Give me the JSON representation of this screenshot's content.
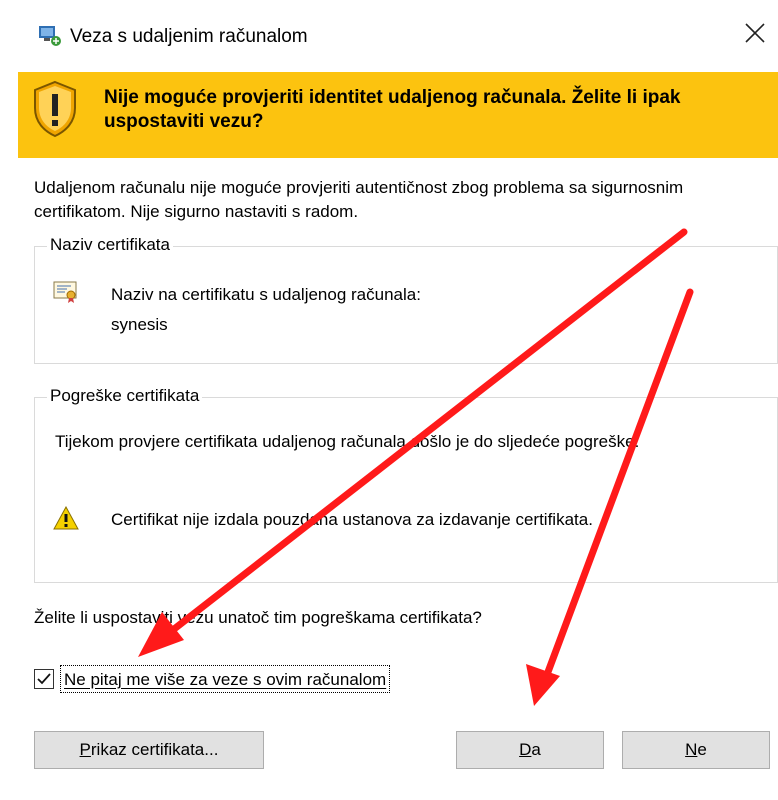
{
  "window": {
    "title": "Veza s udaljenim računalom",
    "app_icon": "remote-desktop-icon",
    "close_icon": "close-icon"
  },
  "banner": {
    "icon": "warning-shield-icon",
    "text": "Nije moguće provjeriti identitet udaljenog računala. Želite li ipak uspostaviti vezu?",
    "color": "#fcc30f"
  },
  "description": "Udaljenom računalu nije moguće provjeriti autentičnost zbog problema sa sigurnosnim certifikatom. Nije sigurno nastaviti s radom.",
  "certificate_name": {
    "legend": "Naziv certifikata",
    "icon": "certificate-icon",
    "label": "Naziv na certifikatu s udaljenog računala:",
    "value": "synesis"
  },
  "certificate_errors": {
    "legend": "Pogreške certifikata",
    "text": "Tijekom provjere certifikata udaljenog računala došlo je do sljedeće pogreške:",
    "icon": "warning-triangle-icon",
    "item": "Certifikat nije izdala pouzdana ustanova za izdavanje certifikata."
  },
  "question": "Želite li uspostaviti vezu unatoč tim pogreškama certifikata?",
  "checkbox": {
    "label": "Ne pitaj me više za veze s ovim računalom",
    "checked": true
  },
  "buttons": {
    "view_cert": {
      "accel": "P",
      "rest": "rikaz certifikata..."
    },
    "yes": {
      "accel": "D",
      "rest": "a"
    },
    "no": {
      "accel": "N",
      "rest": "e"
    }
  },
  "annotation_color": "#ff1a1a"
}
